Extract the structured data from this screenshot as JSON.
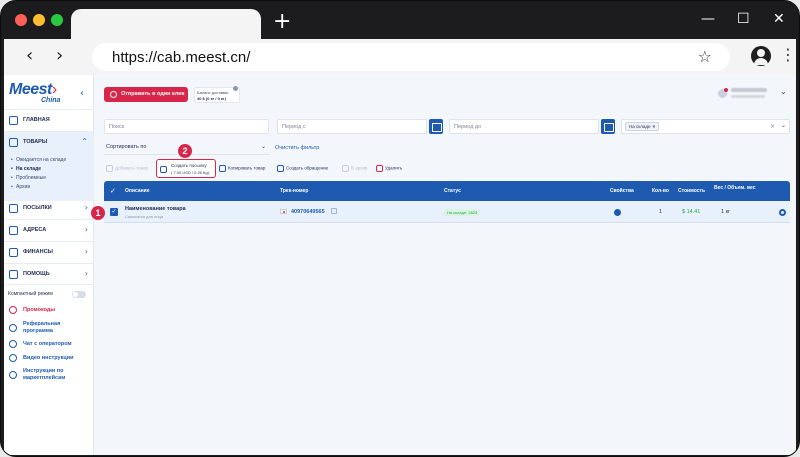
{
  "browser": {
    "url": "https://cab.meest.cn/",
    "new_tab_glyph": "+",
    "minimize_glyph": "—",
    "maximize_glyph": "☐",
    "close_glyph": "✕",
    "back_glyph": "‹",
    "forward_glyph": "›",
    "star_glyph": "☆",
    "menu_glyph": "⋮"
  },
  "logo": {
    "main": "Meest",
    "sub": "China"
  },
  "sidebar": {
    "collapse_glyph": "‹",
    "items": [
      {
        "label": "ГЛАВНАЯ",
        "icon": "grid-icon"
      },
      {
        "label": "ТОВАРЫ",
        "icon": "box-icon",
        "chevron": "⌃"
      },
      {
        "label": "ПОСЫЛКИ",
        "icon": "parcel-icon",
        "chevron": "›"
      },
      {
        "label": "АДРЕСА",
        "icon": "location-icon",
        "chevron": "›"
      },
      {
        "label": "ФИНАНСЫ",
        "icon": "wallet-icon",
        "chevron": "›"
      },
      {
        "label": "ПОМОЩЬ",
        "icon": "help-icon",
        "chevron": "›"
      }
    ],
    "subitems": [
      "Ожидается на складе",
      "На складе",
      "Проблемные",
      "Архив"
    ],
    "compact_mode": "Компактный режим",
    "links": [
      {
        "label": "Промокоды",
        "icon": "promo-icon"
      },
      {
        "label": "Реферальная программа",
        "icon": "referral-icon"
      },
      {
        "label": "Чат с оператором",
        "icon": "chat-icon"
      },
      {
        "label": "Видео инструкции",
        "icon": "video-icon"
      },
      {
        "label": "Инструкции по маркетплейсам",
        "icon": "book-icon"
      }
    ]
  },
  "header": {
    "send_button": "Отправить в один клик",
    "balance_label": "Баланс доставки",
    "balance_value": "40 $ (0 кг / 0 кг)"
  },
  "filters": {
    "search_placeholder": "Поиск",
    "period_from": "Период с",
    "period_to": "Период до",
    "status_chip": "На складе",
    "chip_remove": "×",
    "clear_glyph": "×",
    "chevron_glyph": "⌄",
    "sort_label": "Сортировать по",
    "clear_filter": "Очистить фильтр"
  },
  "actions": {
    "add": "Добавить товар",
    "create_parcel": "Создать посылку",
    "create_parcel_detail": "( 7.00 USD / 0.26 Кg)",
    "copy": "Копировать товар",
    "ticket": "Создать обращение",
    "archive": "В архив",
    "delete": "Удалить"
  },
  "markers": [
    "1",
    "2"
  ],
  "table": {
    "headers": {
      "check": "✓",
      "description": "Описание",
      "track": "Трек-номер",
      "status": "Статус",
      "props": "Свойства",
      "qty": "Кол-во",
      "cost": "Стоимость",
      "weight": "Вес / Объем. вес"
    },
    "rows": [
      {
        "check": "✓",
        "name": "Наименование товара",
        "sub": "Самокатка для лица",
        "track": "40970649565",
        "status": "На складе: 2823",
        "qty": "1",
        "cost": "$ 14.41",
        "weight": "1 кг"
      }
    ]
  }
}
